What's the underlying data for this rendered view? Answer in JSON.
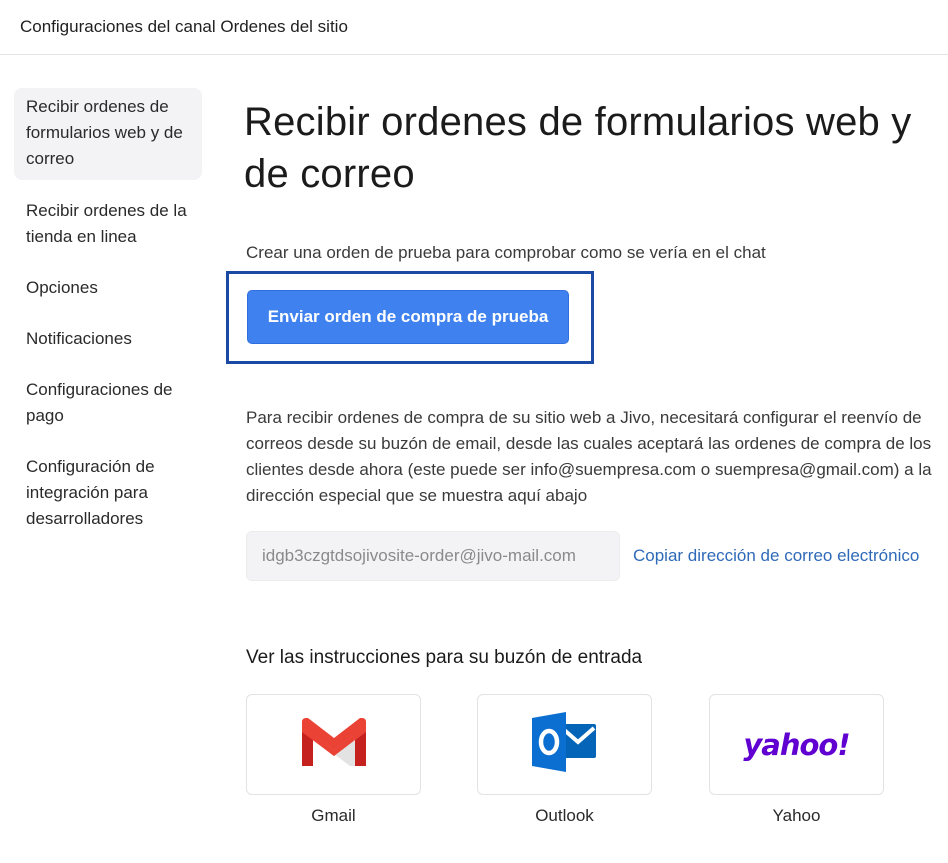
{
  "header": {
    "title": "Configuraciones del canal Ordenes del sitio"
  },
  "sidebar": {
    "items": [
      {
        "label": "Recibir ordenes de formularios web y de correo",
        "active": true
      },
      {
        "label": "Recibir ordenes de la tienda en linea"
      },
      {
        "label": "Opciones"
      },
      {
        "label": "Notificaciones"
      },
      {
        "label": "Configuraciones de pago"
      },
      {
        "label": "Configuración de integración para desarrolladores"
      }
    ]
  },
  "main": {
    "title": "Recibir ordenes de formularios web y de correo",
    "subtitle": "Crear una orden de prueba para comprobar como se vería en el chat",
    "test_button_label": "Enviar orden de compra de prueba",
    "description": "Para recibir ordenes de compra de su sitio web a Jivo, necesitará configurar el reenvío de correos desde su buzón de email, desde las cuales aceptará las ordenes de compra de los clientes desde ahora (este puede ser info@suempresa.com o suempresa@gmail.com) a la dirección especial que se muestra aquí abajo",
    "email_value": "idgb3czgtdsojivosite-order@jivo-mail.com",
    "copy_link_label": "Copiar dirección de correo electrónico",
    "instructions_heading": "Ver las instrucciones para su buzón de entrada",
    "providers": [
      {
        "label": "Gmail",
        "icon": "gmail-icon"
      },
      {
        "label": "Outlook",
        "icon": "outlook-icon"
      },
      {
        "label": "Yahoo",
        "icon": "yahoo-icon",
        "logo_text": "yahoo!"
      }
    ]
  },
  "colors": {
    "accent": "#3f82ef",
    "highlight_border": "#1a4aa3",
    "link": "#2f6ab8",
    "yahoo_purple": "#6001d2"
  }
}
